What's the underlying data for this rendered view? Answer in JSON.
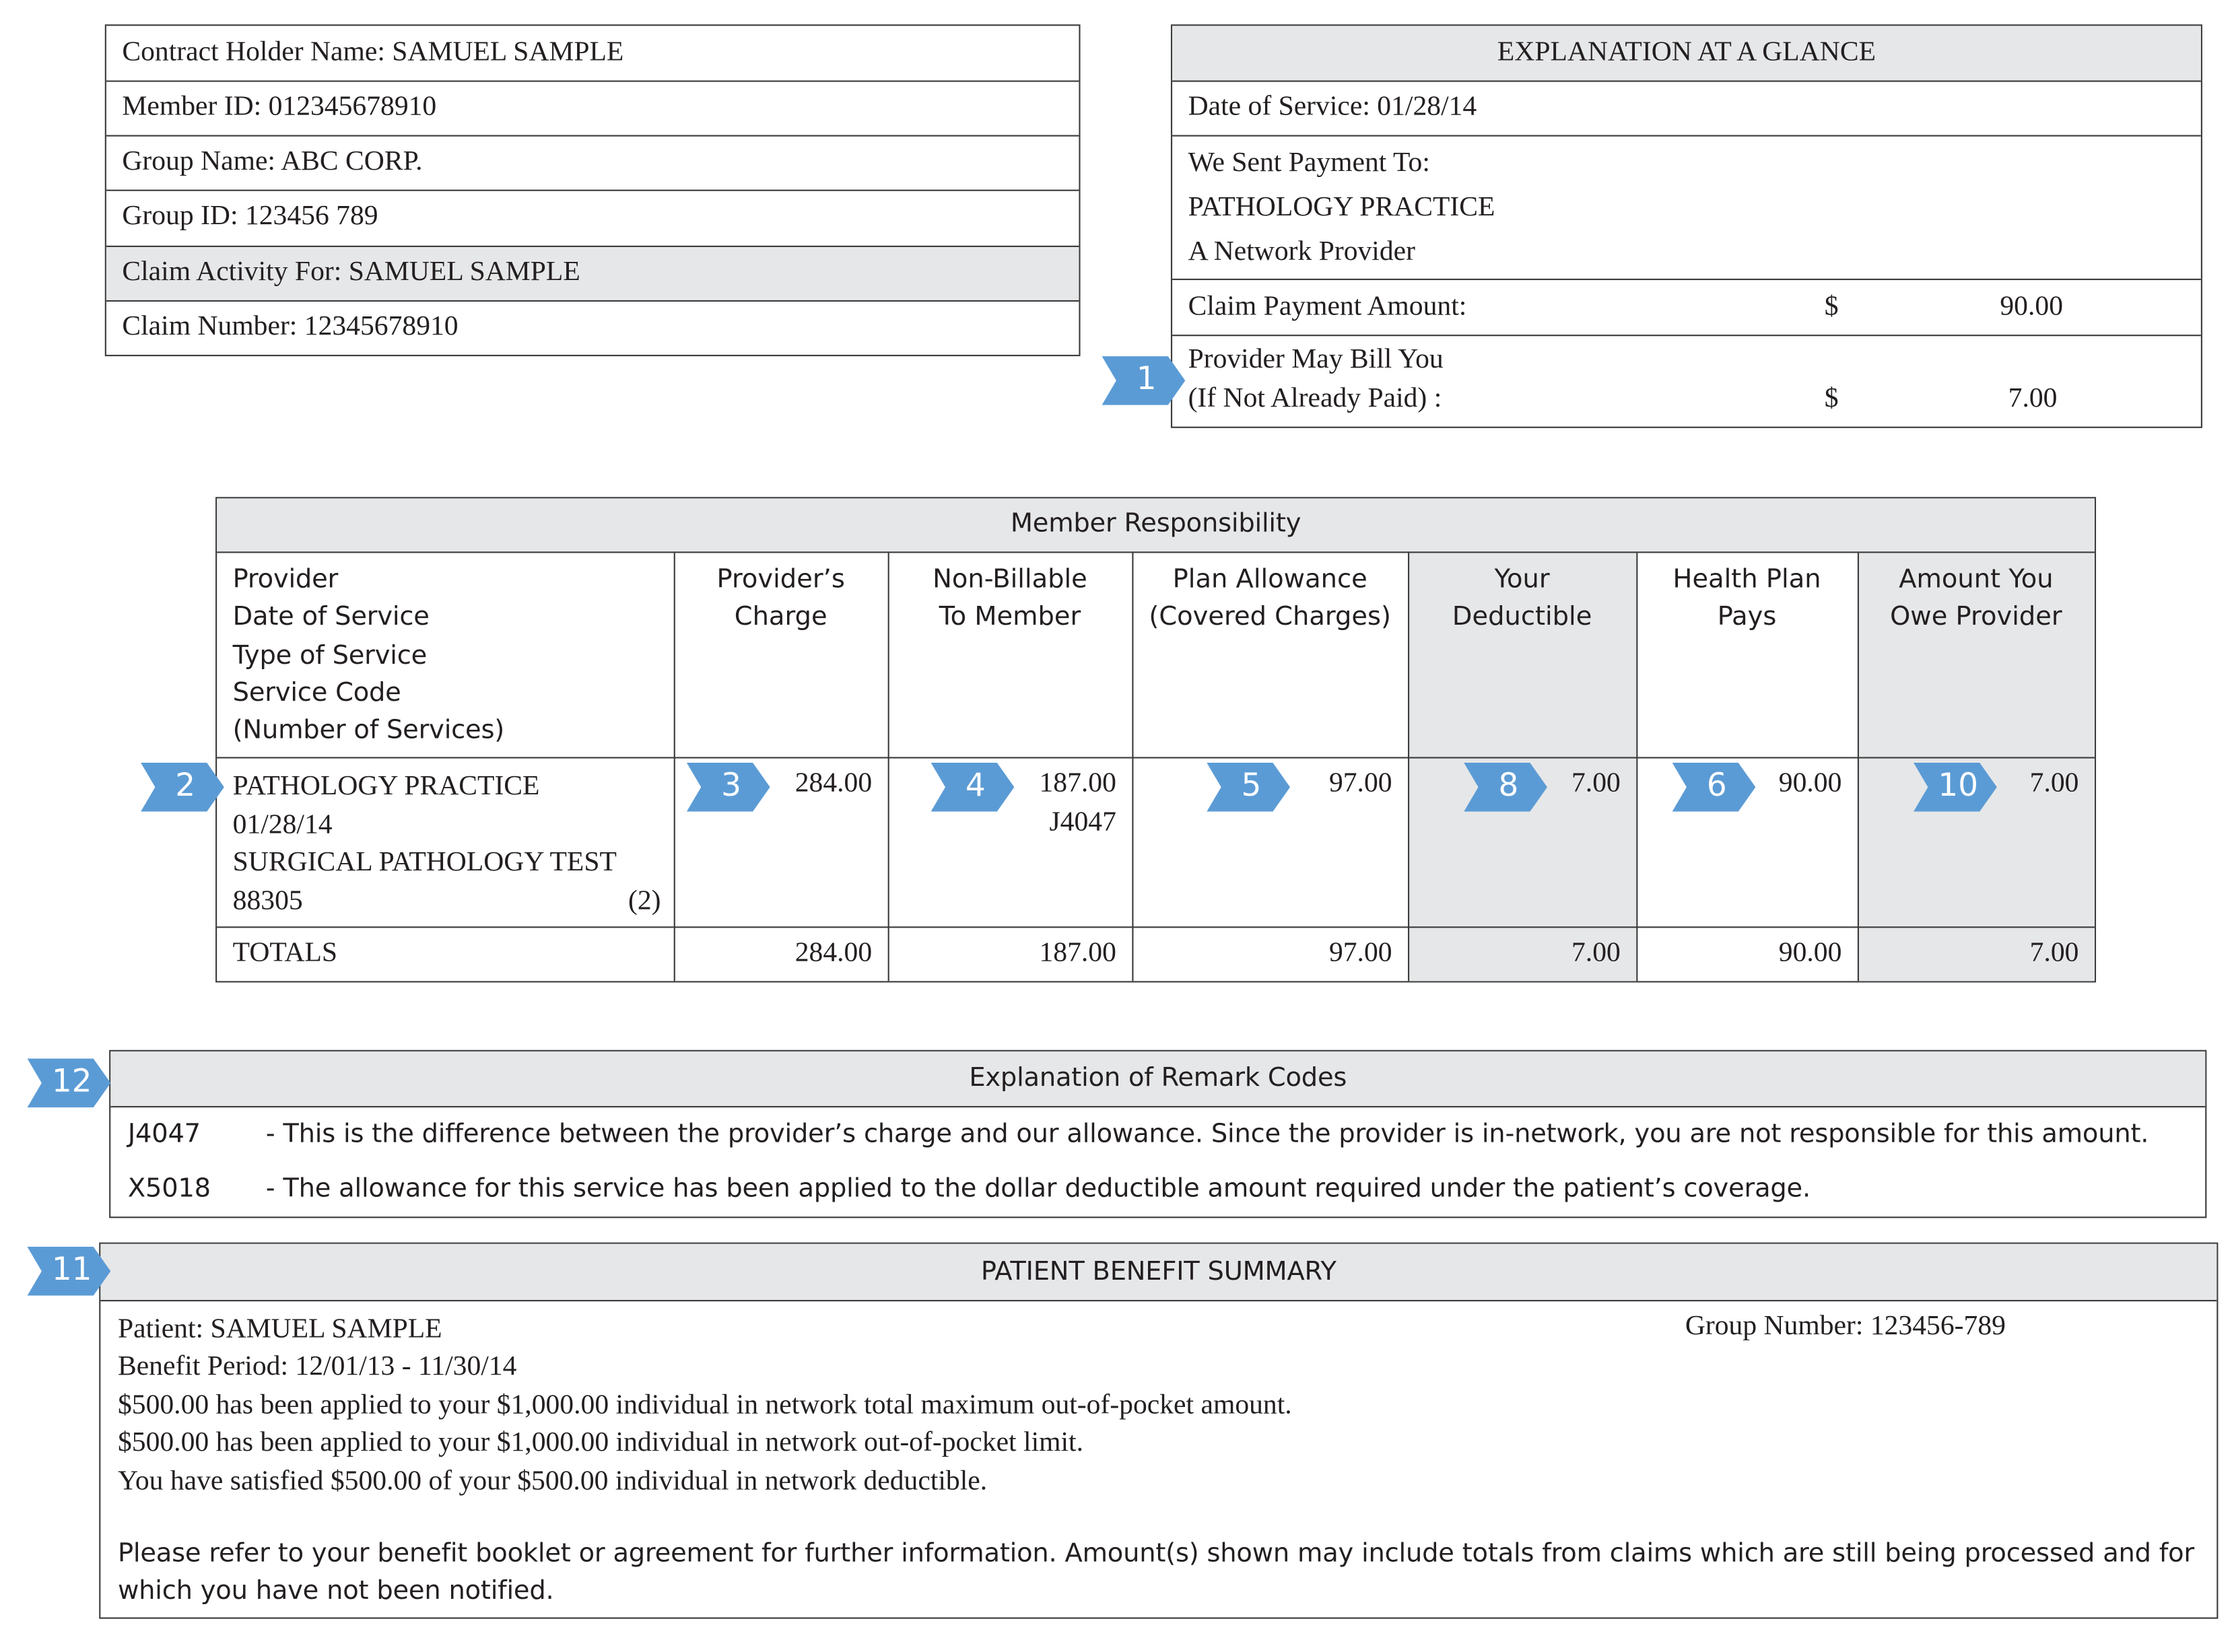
{
  "contract_box": {
    "contract_holder": "Contract Holder Name: SAMUEL SAMPLE",
    "member_id": "Member ID: 012345678910",
    "group_name": "Group Name: ABC CORP.",
    "group_id": "Group ID: 123456 789",
    "claim_activity": "Claim Activity For: SAMUEL SAMPLE",
    "claim_number": "Claim Number: 12345678910"
  },
  "glance": {
    "title": "EXPLANATION AT A GLANCE",
    "date_of_service": "Date of Service: 01/28/14",
    "sent_payment_label": "We Sent Payment To:",
    "payee": "PATHOLOGY PRACTICE",
    "payee_type": "A Network Provider",
    "claim_payment_label": "Claim Payment Amount:",
    "claim_payment_currency": "$",
    "claim_payment_value": "90.00",
    "may_bill_line1": "Provider May Bill You",
    "may_bill_line2": "(If Not Already Paid) :",
    "may_bill_currency": "$",
    "may_bill_value": "7.00"
  },
  "member_resp": {
    "title": "Member Responsibility",
    "headers": {
      "provider": [
        "Provider",
        "Date of Service",
        "Type of Service",
        "Service Code",
        "(Number of Services)"
      ],
      "charge": [
        "Provider’s",
        "Charge"
      ],
      "non_billable": [
        "Non-Billable",
        "To Member"
      ],
      "allowance": [
        "Plan Allowance",
        "(Covered Charges)"
      ],
      "deductible": [
        "Your",
        "Deductible"
      ],
      "plan_pays": [
        "Health Plan",
        "Pays"
      ],
      "owe": [
        "Amount You",
        "Owe  Provider"
      ]
    },
    "row": {
      "provider": "PATHOLOGY PRACTICE",
      "date": "01/28/14",
      "service": "SURGICAL PATHOLOGY TEST",
      "code": "88305",
      "count": "(2)",
      "charge": "284.00",
      "non_billable": "187.00",
      "non_billable_code": "J4047",
      "allowance": "97.00",
      "deductible": "7.00",
      "plan_pays": "90.00",
      "owe": "7.00"
    },
    "totals": {
      "label": "TOTALS",
      "charge": "284.00",
      "non_billable": "187.00",
      "allowance": "97.00",
      "deductible": "7.00",
      "plan_pays": "90.00",
      "owe": "7.00"
    }
  },
  "remarks": {
    "title": "Explanation of Remark Codes",
    "items": [
      {
        "code": "J4047",
        "text": "- This is the difference between the provider’s charge and our allowance. Since the provider is in-network, you are not responsible for this amount."
      },
      {
        "code": "X5018",
        "text": "- The allowance for this service has been applied to the dollar deductible amount required under the patient’s coverage."
      }
    ]
  },
  "summary": {
    "title": "PATIENT BENEFIT SUMMARY",
    "patient": "Patient: SAMUEL SAMPLE",
    "group_number": "Group Number: 123456-789",
    "benefit_period": "Benefit Period: 12/01/13 - 11/30/14",
    "line1": "$500.00 has been applied to your $1,000.00 individual in network total maximum out-of-pocket amount.",
    "line2": "$500.00 has been applied to your $1,000.00 individual in network out-of-pocket limit.",
    "line3": "You have satisfied $500.00 of your $500.00 individual in network deductible.",
    "note_line1": "Please refer to your benefit booklet or agreement for further information. Amount(s) shown may include totals from claims which are still being processed and for",
    "note_line2": "which you have not been notified."
  },
  "badges": {
    "b1": "1",
    "b2": "2",
    "b3": "3",
    "b4": "4",
    "b5": "5",
    "b6": "6",
    "b8": "8",
    "b10": "10",
    "b11": "11",
    "b12": "12"
  },
  "colors": {
    "badge": "#5b9bd5",
    "header_gray": "#e6e7e8",
    "border": "#3c3c3c"
  }
}
